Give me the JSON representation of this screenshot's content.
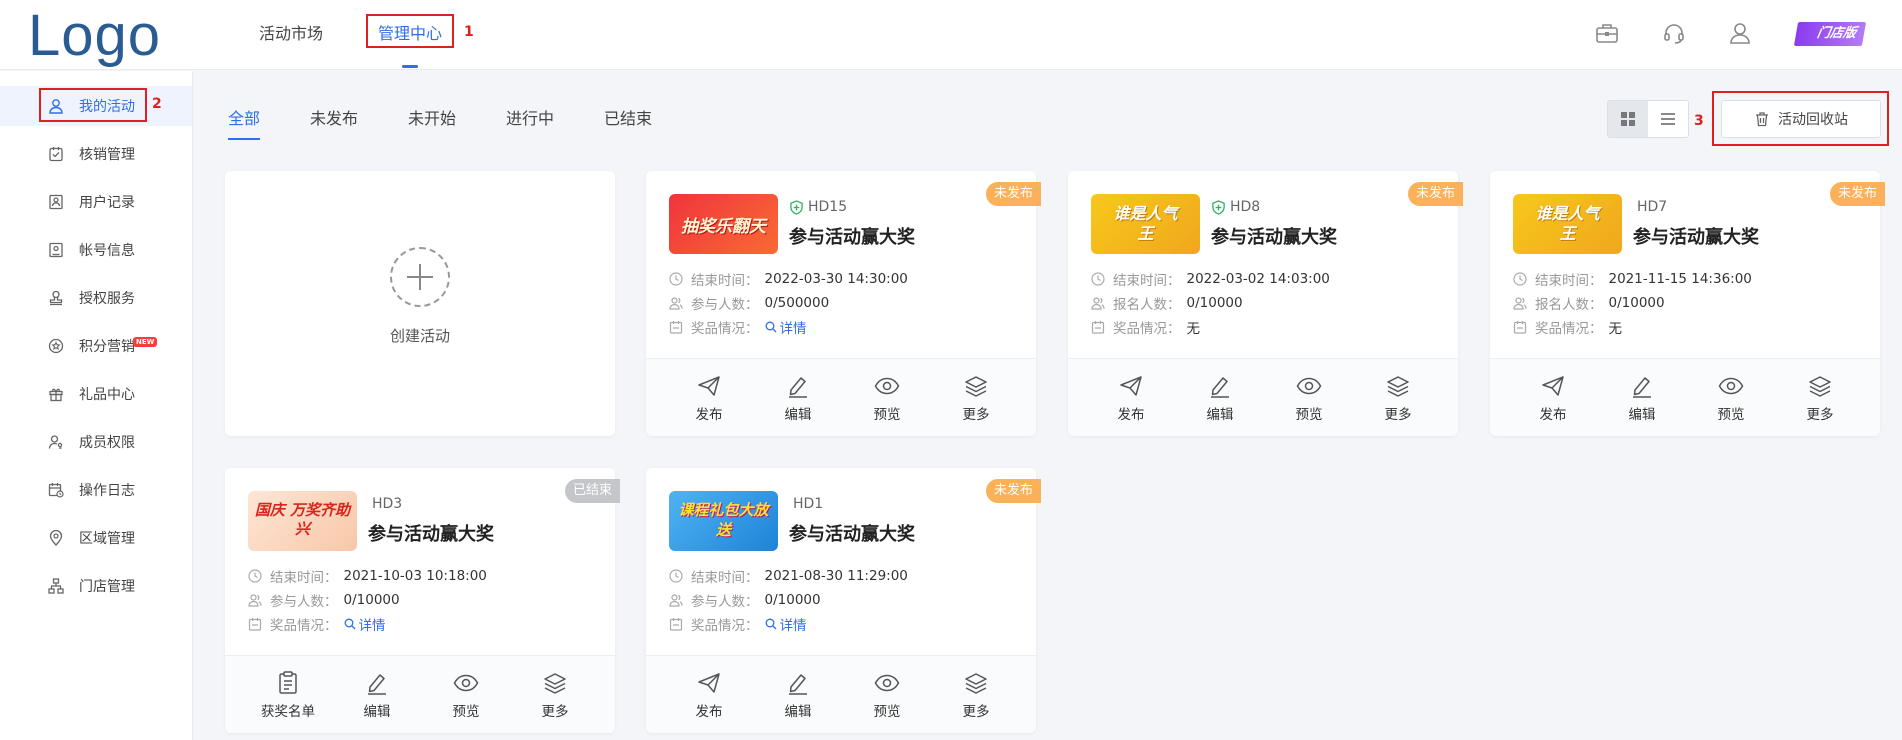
{
  "logo": "Logo",
  "topnav": {
    "market": "活动市场",
    "manage": "管理中心",
    "store_badge": "门店版"
  },
  "annotations": {
    "a1": "1",
    "a2": "2",
    "a3": "3"
  },
  "sidebar": {
    "items": [
      {
        "label": "我的活动",
        "icon": "user-icon"
      },
      {
        "label": "核销管理",
        "icon": "clipboard-check-icon"
      },
      {
        "label": "用户记录",
        "icon": "id-card-icon"
      },
      {
        "label": "帐号信息",
        "icon": "account-card-icon"
      },
      {
        "label": "授权服务",
        "icon": "stamp-icon"
      },
      {
        "label": "积分营销",
        "icon": "star-badge-icon",
        "badge": "NEW"
      },
      {
        "label": "礼品中心",
        "icon": "gift-icon"
      },
      {
        "label": "成员权限",
        "icon": "user-key-icon"
      },
      {
        "label": "操作日志",
        "icon": "calendar-log-icon"
      },
      {
        "label": "区域管理",
        "icon": "location-icon"
      },
      {
        "label": "门店管理",
        "icon": "org-tree-icon"
      }
    ]
  },
  "filters": [
    "全部",
    "未发布",
    "未开始",
    "进行中",
    "已结束"
  ],
  "recycle_label": "活动回收站",
  "create_label": "创建活动",
  "labels": {
    "end_time": "结束时间：",
    "participants": "参与人数：",
    "signups": "报名人数：",
    "prize": "奖品情况：",
    "details": "详情",
    "none": "无"
  },
  "cards": [
    {
      "code": "HD15",
      "title": "参与活动赢大奖",
      "status": "未发布",
      "end_time": "2022-03-30 14:30:00",
      "count_label": "参与人数：",
      "count": "0/500000",
      "prize": "详情",
      "verified": true,
      "thumb_text": "抽奖乐翻天",
      "actions": [
        "发布",
        "编辑",
        "预览",
        "更多"
      ]
    },
    {
      "code": "HD8",
      "title": "参与活动赢大奖",
      "status": "未发布",
      "end_time": "2022-03-02 14:03:00",
      "count_label": "报名人数：",
      "count": "0/10000",
      "prize": "无",
      "verified": true,
      "thumb_text": "谁是人气王",
      "actions": [
        "发布",
        "编辑",
        "预览",
        "更多"
      ]
    },
    {
      "code": "HD7",
      "title": "参与活动赢大奖",
      "status": "未发布",
      "end_time": "2021-11-15 14:36:00",
      "count_label": "报名人数：",
      "count": "0/10000",
      "prize": "无",
      "verified": false,
      "thumb_text": "谁是人气王",
      "actions": [
        "发布",
        "编辑",
        "预览",
        "更多"
      ]
    },
    {
      "code": "HD3",
      "title": "参与活动赢大奖",
      "status": "已结束",
      "end_time": "2021-10-03 10:18:00",
      "count_label": "参与人数：",
      "count": "0/10000",
      "prize": "详情",
      "verified": false,
      "thumb_text": "国庆 万奖齐助兴",
      "actions": [
        "获奖名单",
        "编辑",
        "预览",
        "更多"
      ]
    },
    {
      "code": "HD1",
      "title": "参与活动赢大奖",
      "status": "未发布",
      "end_time": "2021-08-30 11:29:00",
      "count_label": "参与人数：",
      "count": "0/10000",
      "prize": "详情",
      "verified": false,
      "thumb_text": "课程礼包大放送",
      "actions": [
        "发布",
        "编辑",
        "预览",
        "更多"
      ]
    }
  ],
  "colors": {
    "accent": "#2f6fe8",
    "status_orange": "#fbb05a",
    "status_gray": "#c4c6ca",
    "annotation_red": "#e02020"
  }
}
